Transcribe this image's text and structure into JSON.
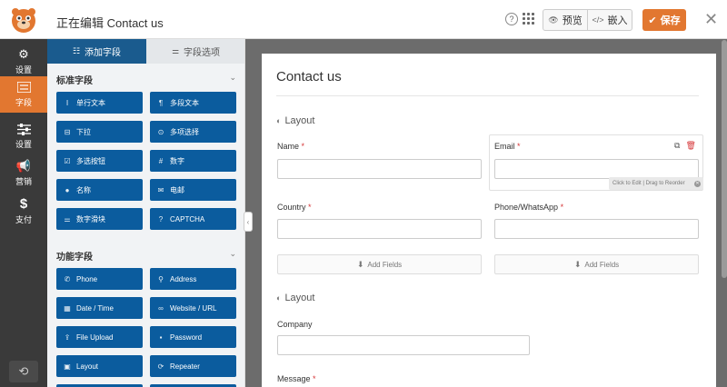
{
  "header": {
    "editing_title": "正在编辑 Contact us",
    "help_icon": "help-circle-icon",
    "preview_label": "预览",
    "embed_label": "嵌入",
    "save_label": "保存"
  },
  "leftnav": {
    "items": [
      {
        "label": "设置",
        "icon": "gear-icon"
      },
      {
        "label": "字段",
        "icon": "list-icon"
      },
      {
        "label": "设置",
        "icon": "sliders-icon"
      },
      {
        "label": "营销",
        "icon": "megaphone-icon"
      },
      {
        "label": "支付",
        "icon": "dollar-icon"
      }
    ]
  },
  "panel": {
    "tabs": [
      {
        "label": "添加字段"
      },
      {
        "label": "字段选项"
      }
    ],
    "standard_group": "标准字段",
    "standard_fields": [
      "单行文本",
      "多段文本",
      "下拉",
      "多项选择",
      "多选按钮",
      "数字",
      "名称",
      "电邮",
      "数字滑块",
      "CAPTCHA"
    ],
    "fancy_group": "功能字段",
    "fancy_fields": [
      "Phone",
      "Address",
      "Date / Time",
      "Website / URL",
      "File Upload",
      "Password",
      "Layout",
      "Repeater"
    ]
  },
  "form": {
    "title": "Contact us",
    "layout_label": "Layout",
    "name_label": "Name",
    "email_label": "Email",
    "country_label": "Country",
    "phone_label": "Phone/WhatsApp",
    "add_fields_label": "Add Fields",
    "reorder_hint": "Click to Edit | Drag to Reorder",
    "company_label": "Company",
    "message_label": "Message",
    "required_mark": "*"
  },
  "colors": {
    "accent": "#e27730",
    "field_button": "#0b5c9e",
    "nav_bg": "#3a3a3a",
    "tab_active": "#1a5b8e"
  }
}
